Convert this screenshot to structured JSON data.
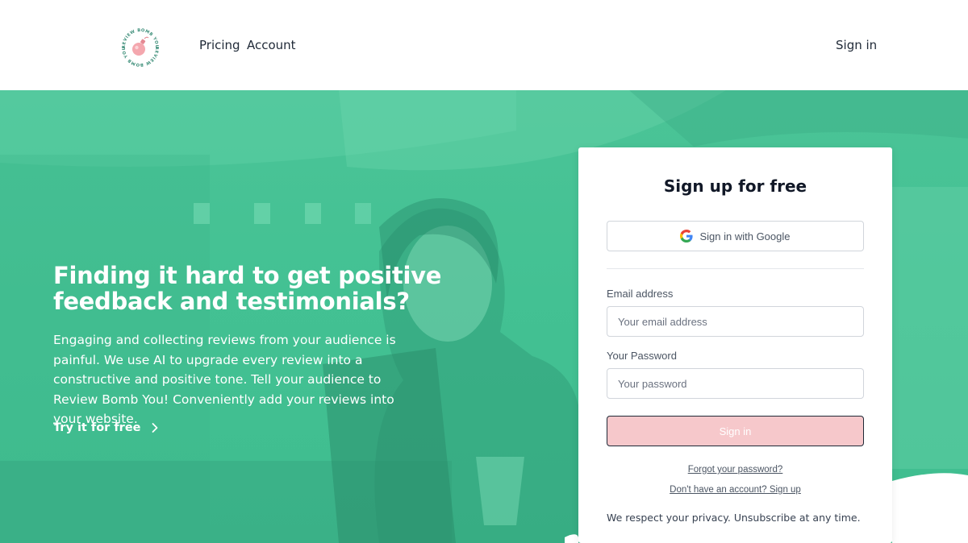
{
  "header": {
    "logo_text_top": "REVIEW BOMB YOU",
    "logo_text_bottom": "REVIEW BOMB YOU",
    "nav": [
      {
        "label": "Pricing"
      },
      {
        "label": "Account"
      }
    ],
    "signin_label": "Sign in"
  },
  "hero": {
    "title_line1": "Finding it hard to get positive",
    "title_line2": "feedback and testimonials?",
    "description": "Engaging and collecting reviews from your audience is painful. We use AI to upgrade every review into a constructive and positive tone. Tell your audience to Review Bomb You! Conveniently add your reviews into your website.",
    "cta_label": "Try it for free",
    "cta_icon": "chevron-right-icon",
    "accent_color": "#43c193"
  },
  "signup": {
    "title": "Sign up for free",
    "google_label": "Sign in with Google",
    "google_icon": "google-icon",
    "email_label": "Email address",
    "email_placeholder": "Your email address",
    "email_value": "",
    "password_label": "Your Password",
    "password_placeholder": "Your password",
    "password_value": "",
    "submit_label": "Sign in",
    "submit_color": "#f6c8cb",
    "forgot_label": "Forgot your password?",
    "no_account_label": "Don't have an account? Sign up",
    "privacy_text": "We respect your privacy. Unsubscribe at any time."
  }
}
